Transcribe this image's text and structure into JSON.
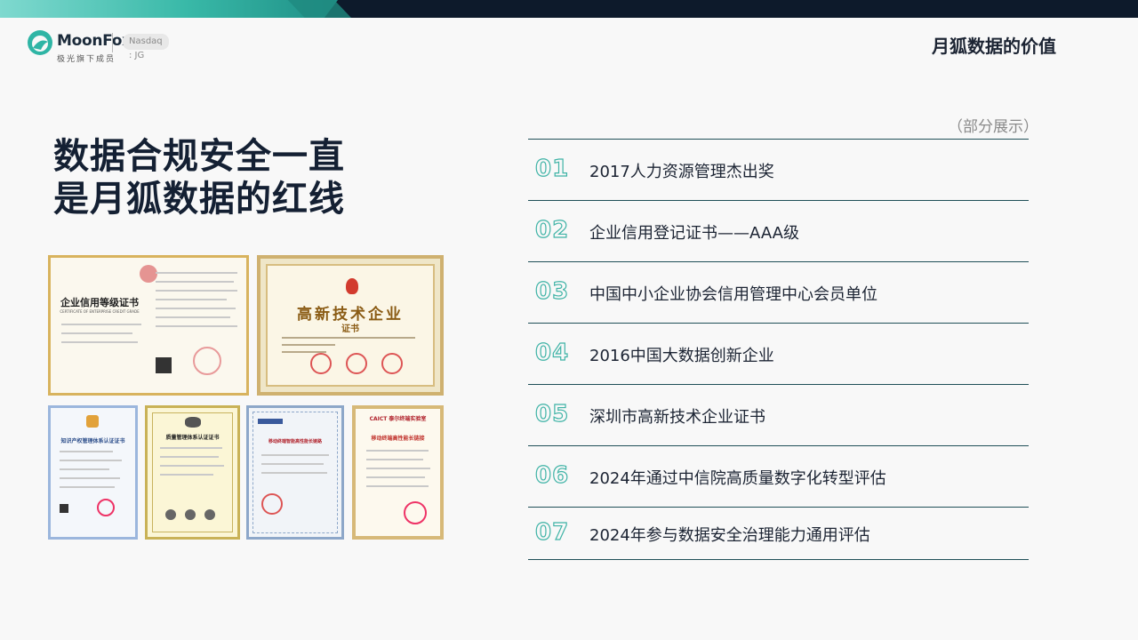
{
  "brand": {
    "name": "MoonFox",
    "tagline": "极光旗下成员",
    "exchange": "Nasdaq : JG"
  },
  "page_title": "月狐数据的价值",
  "headline": {
    "line1": "数据合规安全一直",
    "line2": "是月狐数据的红线"
  },
  "note": "（部分展示）",
  "items": [
    {
      "num": "01",
      "label": "2017人力资源管理杰出奖"
    },
    {
      "num": "02",
      "label": "企业信用登记证书——AAA级"
    },
    {
      "num": "03",
      "label": "中国中小企业协会信用管理中心会员单位"
    },
    {
      "num": "04",
      "label": "2016中国大数据创新企业"
    },
    {
      "num": "05",
      "label": "深圳市高新技术企业证书"
    },
    {
      "num": "06",
      "label": "2024年通过中信院高质量数字化转型评估"
    },
    {
      "num": "07",
      "label": "2024年参与数据安全治理能力通用评估"
    }
  ],
  "certificates": {
    "credit": {
      "title": "企业信用等级证书",
      "subtitle": "CERTIFICATE OF ENTERPRISE CREDIT GRADE"
    },
    "hightech": {
      "title": "高新技术企业",
      "subtitle": "证书"
    },
    "ip": {
      "title": "知识产权管理体系认证证书"
    },
    "quality": {
      "title": "质量管理体系认证证书"
    },
    "caict_a": {
      "title": "移动终端智能高性能长链路"
    },
    "caict_b": {
      "brand": "CAICT 泰尔终端实验室",
      "title": "移动终端高性能长链接"
    }
  },
  "colors": {
    "accent": "#3fb3a6",
    "navy": "#0d1a2b",
    "rule": "#1f4f58"
  }
}
